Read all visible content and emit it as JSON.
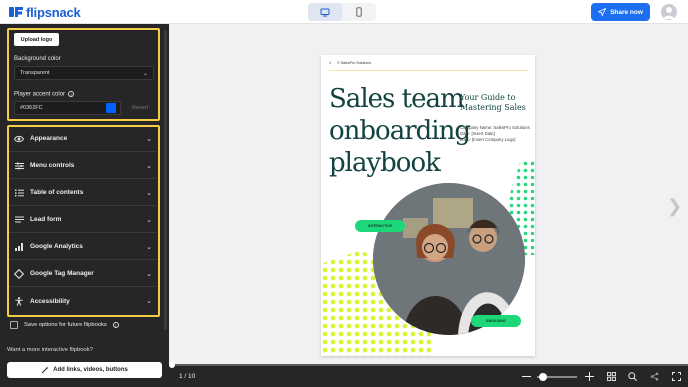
{
  "app": {
    "brand": "flipsnack"
  },
  "header": {
    "share_label": "Share now"
  },
  "sidebar": {
    "upload_logo_label": "Upload logo",
    "background_color_label": "Background color",
    "background_color_value": "Transparent",
    "accent_color_label": "Player accent color",
    "accent_color_value": "#0362FC",
    "revert_label": "Revert",
    "sections": [
      {
        "label": "Appearance",
        "icon": "eye-icon"
      },
      {
        "label": "Menu controls",
        "icon": "sliders-icon"
      },
      {
        "label": "Table of contents",
        "icon": "list-icon"
      },
      {
        "label": "Lead form",
        "icon": "form-lines-icon"
      },
      {
        "label": "Google Analytics",
        "icon": "bar-chart-icon"
      },
      {
        "label": "Google Tag Manager",
        "icon": "diamond-icon"
      },
      {
        "label": "Accessibility",
        "icon": "person-icon"
      }
    ],
    "save_options_label": "Save options for future flipbooks",
    "interactive_prompt": "Want a more interactive flipbook?",
    "add_links_label": "Add links, videos, buttons"
  },
  "document": {
    "page_marker": "1",
    "company": "© SalesPro Solutions",
    "title_lines": [
      "Sales team",
      "onboarding",
      "playbook"
    ],
    "guide_lines": [
      "Your Guide to",
      "Mastering Sales"
    ],
    "meta_lines": [
      "Company Name: SalesPro Solutions",
      "Date: [Insert Date]",
      "Logo: [Insert Company Logo]"
    ],
    "pill_left": "INTERACTIVE",
    "pill_right": "ENGAGING"
  },
  "player": {
    "page_indicator": "1 / 10"
  },
  "colors": {
    "accent": "#0362FC",
    "share": "#1D6FF2",
    "highlight": "#F5CC45",
    "pill": "#1DD879"
  }
}
